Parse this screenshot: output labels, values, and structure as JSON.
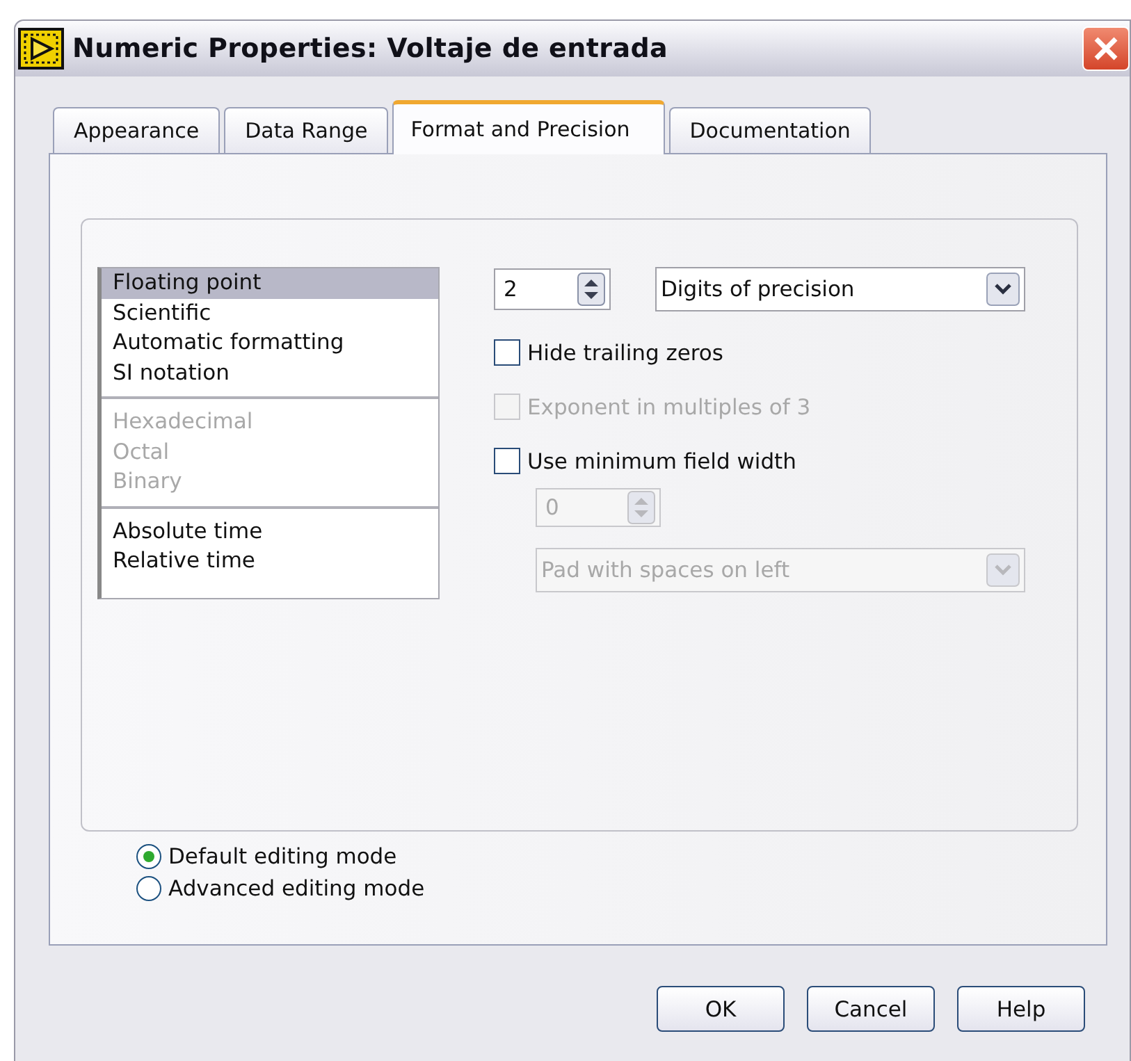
{
  "window": {
    "title": "Numeric Properties: Voltaje de entrada"
  },
  "tabs": [
    {
      "label": "Appearance",
      "selected": false
    },
    {
      "label": "Data Range",
      "selected": false
    },
    {
      "label": "Format and Precision",
      "selected": true
    },
    {
      "label": "Documentation",
      "selected": false
    }
  ],
  "format_list": {
    "groups": [
      [
        {
          "label": "Floating point",
          "selected": true,
          "disabled": false
        },
        {
          "label": "Scientific",
          "selected": false,
          "disabled": false
        },
        {
          "label": "Automatic formatting",
          "selected": false,
          "disabled": false
        },
        {
          "label": "SI notation",
          "selected": false,
          "disabled": false
        }
      ],
      [
        {
          "label": "Hexadecimal",
          "selected": false,
          "disabled": true
        },
        {
          "label": "Octal",
          "selected": false,
          "disabled": true
        },
        {
          "label": "Binary",
          "selected": false,
          "disabled": true
        }
      ],
      [
        {
          "label": "Absolute time",
          "selected": false,
          "disabled": false
        },
        {
          "label": "Relative time",
          "selected": false,
          "disabled": false
        }
      ]
    ]
  },
  "precision": {
    "value": "2",
    "type": "Digits of precision"
  },
  "options": [
    {
      "label": "Hide trailing zeros",
      "checked": false,
      "disabled": false
    },
    {
      "label": "Exponent in multiples of 3",
      "checked": false,
      "disabled": true
    },
    {
      "label": "Use minimum field width",
      "checked": false,
      "disabled": false
    }
  ],
  "field_width": {
    "value": "0",
    "padding": "Pad with spaces on left",
    "disabled": true
  },
  "editing_modes": [
    {
      "label": "Default editing mode",
      "selected": true
    },
    {
      "label": "Advanced editing mode",
      "selected": false
    }
  ],
  "buttons": [
    "OK",
    "Cancel",
    "Help"
  ]
}
